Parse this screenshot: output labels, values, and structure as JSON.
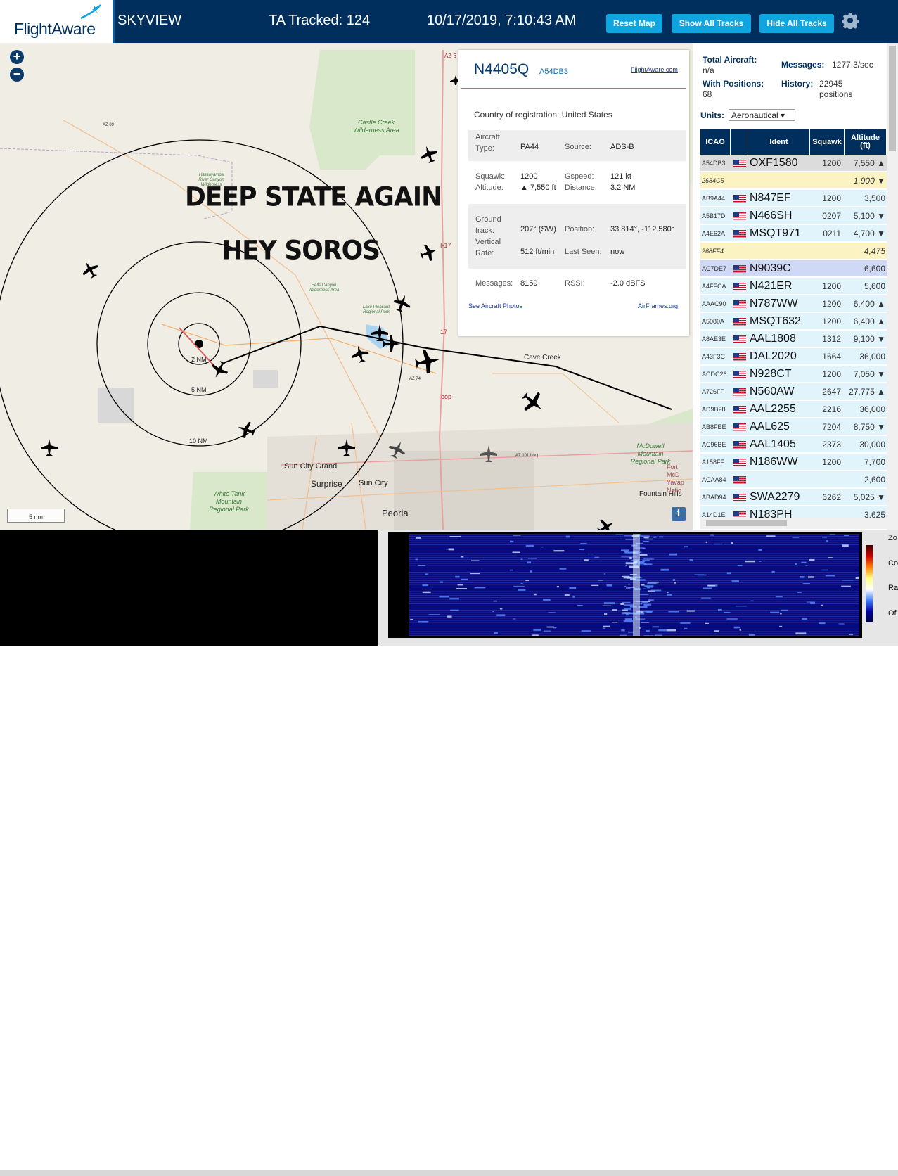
{
  "header": {
    "logo_text": "FlightAware",
    "app_name": "SKYVIEW",
    "tracked": "TA Tracked: 124",
    "datetime": "10/17/2019, 7:10:43 AM",
    "reset_map": "Reset Map",
    "show_all_tracks": "Show All Tracks",
    "hide_all_tracks": "Hide All Tracks"
  },
  "map": {
    "zoom_in": "+",
    "zoom_out": "−",
    "overlay_line1": "DEEP STATE AGAIN",
    "overlay_line2": "HEY SOROS",
    "scale": "5 nm",
    "info": "i",
    "rings": [
      "2 NM",
      "5 NM",
      "10 NM"
    ],
    "towns": [
      "Cave Creek",
      "Sun City Grand",
      "Surprise",
      "Sun City",
      "Peoria",
      "Fountain Hills",
      "Fort McD Yavap Natio"
    ],
    "parks": [
      "Castle Creek Wilderness Area",
      "McDowell Mountain Regional Park",
      "White Tank Mountain Regional Park",
      "Lake Pleasant Regional Park",
      "Hells Canyon Wilderness Area",
      "Hassayampa River Canyon Wilderness"
    ],
    "roads": [
      "AZ 89",
      "AZ 6",
      "I-17",
      "17",
      "AZ 74",
      "oop",
      "AZ 101 Loop"
    ]
  },
  "selected": {
    "ident": "N4405Q",
    "hex": "A54DB3",
    "fa_link": "FlightAware.com",
    "country_label": "Country of registration:",
    "country": "United States",
    "aircraft_type_label": "Aircraft Type:",
    "aircraft_type": "PA44",
    "source_label": "Source:",
    "source": "ADS-B",
    "squawk_label": "Squawk:",
    "squawk": "1200",
    "gspeed_label": "Gspeed:",
    "gspeed": "121 kt",
    "altitude_label": "Altitude:",
    "altitude": "▲ 7,550 ft",
    "distance_label": "Distance:",
    "distance": "3.2 NM",
    "ground_track_label": "Ground track:",
    "ground_track": "207° (SW)",
    "position_label": "Position:",
    "position": "33.814°, -112.580°",
    "vertical_rate_label": "Vertical Rate:",
    "vertical_rate": "512 ft/min",
    "last_seen_label": "Last Seen:",
    "last_seen": "now",
    "messages_label": "Messages:",
    "messages": "8159",
    "rssi_label": "RSSI:",
    "rssi": "-2.0 dBFS",
    "photos_link": "See Aircraft Photos",
    "airframes_link": "AirFrames.org"
  },
  "sidebar": {
    "total_aircraft_label": "Total Aircraft:",
    "total_aircraft": "n/a",
    "messages_label": "Messages:",
    "messages": "1277.3/sec",
    "with_positions_label": "With Positions:",
    "with_positions": "68",
    "history_label": "History:",
    "history": "22945 positions",
    "units_label": "Units:",
    "units_value": "Aeronautical ▾",
    "columns": [
      "ICAO",
      "",
      "Ident",
      "Squawk",
      "Altitude (ft)"
    ],
    "rows": [
      {
        "icao": "A54DB3",
        "flag": "us",
        "ident": "OXF1580",
        "squawk": "1200",
        "alt": "7,550 ▲",
        "style": "selected"
      },
      {
        "icao": "2684C5",
        "flag": "",
        "ident": "",
        "squawk": "",
        "alt": "1,900 ▼",
        "style": "nopos"
      },
      {
        "icao": "AB9A44",
        "flag": "us",
        "ident": "N847EF",
        "squawk": "1200",
        "alt": "3,500",
        "style": "normal"
      },
      {
        "icao": "A5B17D",
        "flag": "us",
        "ident": "N466SH",
        "squawk": "0207",
        "alt": "5,100 ▼",
        "style": "normal"
      },
      {
        "icao": "A4E62A",
        "flag": "us",
        "ident": "MSQT971",
        "squawk": "0211",
        "alt": "4,700 ▼",
        "style": "normal"
      },
      {
        "icao": "268FF4",
        "flag": "",
        "ident": "",
        "squawk": "",
        "alt": "4,475",
        "style": "nopos"
      },
      {
        "icao": "AC7DE7",
        "flag": "us",
        "ident": "N9039C",
        "squawk": "",
        "alt": "6,600",
        "style": "mlat"
      },
      {
        "icao": "A4FFCA",
        "flag": "us",
        "ident": "N421ER",
        "squawk": "1200",
        "alt": "5,600",
        "style": "normal"
      },
      {
        "icao": "AAAC90",
        "flag": "us",
        "ident": "N787WW",
        "squawk": "1200",
        "alt": "6,400 ▲",
        "style": "normal"
      },
      {
        "icao": "A5080A",
        "flag": "us",
        "ident": "MSQT632",
        "squawk": "1200",
        "alt": "6,400 ▲",
        "style": "normal"
      },
      {
        "icao": "A8AE3E",
        "flag": "us",
        "ident": "AAL1808",
        "squawk": "1312",
        "alt": "9,100 ▼",
        "style": "normal"
      },
      {
        "icao": "A43F3C",
        "flag": "us",
        "ident": "DAL2020",
        "squawk": "1664",
        "alt": "36,000",
        "style": "normal"
      },
      {
        "icao": "ACDC26",
        "flag": "us",
        "ident": "N928CT",
        "squawk": "1200",
        "alt": "7,050 ▼",
        "style": "normal"
      },
      {
        "icao": "A726FF",
        "flag": "us",
        "ident": "N560AW",
        "squawk": "2647",
        "alt": "27,775 ▲",
        "style": "normal"
      },
      {
        "icao": "AD9B28",
        "flag": "us",
        "ident": "AAL2255",
        "squawk": "2216",
        "alt": "36,000",
        "style": "normal"
      },
      {
        "icao": "AB8FEE",
        "flag": "us",
        "ident": "AAL625",
        "squawk": "7204",
        "alt": "8,750 ▼",
        "style": "normal"
      },
      {
        "icao": "AC96BE",
        "flag": "us",
        "ident": "AAL1405",
        "squawk": "2373",
        "alt": "30,000",
        "style": "normal"
      },
      {
        "icao": "A158FF",
        "flag": "us",
        "ident": "N186WW",
        "squawk": "1200",
        "alt": "7,700",
        "style": "normal"
      },
      {
        "icao": "ACAA84",
        "flag": "us",
        "ident": "",
        "squawk": "",
        "alt": "2,600",
        "style": "normal"
      },
      {
        "icao": "ABAD94",
        "flag": "us",
        "ident": "SWA2279",
        "squawk": "6262",
        "alt": "5,025 ▼",
        "style": "normal"
      },
      {
        "icao": "A14D1E",
        "flag": "us",
        "ident": "N183PH",
        "squawk": "",
        "alt": "3,625",
        "style": "normal"
      }
    ]
  },
  "bottom_panel": {
    "side_labels": [
      "Zo",
      "Con",
      "Ra",
      "Of"
    ]
  },
  "colors": {
    "header_bg": "#002f5d",
    "button_bg": "#0fa5e0",
    "row_normal": "#e1f3fb",
    "row_selected": "#dcdcdc",
    "row_nopos": "#fbf3c1",
    "row_mlat": "#cfd8f5"
  }
}
